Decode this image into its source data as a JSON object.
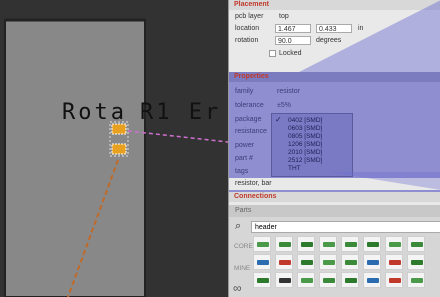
{
  "canvas": {
    "part_label": "Rota",
    "part_label2": "R1 Er",
    "colors": {
      "trace": "#c06a2a",
      "ratsnest": "#d070d0",
      "board": "#888888"
    }
  },
  "inspector": {
    "placement": {
      "header": "Placement",
      "pcb_layer_label": "pcb layer",
      "pcb_layer_value": "top",
      "location_label": "location",
      "location_x": "1.467",
      "location_y": "0.433",
      "location_unit": "in",
      "rotation_label": "rotation",
      "rotation_value": "90.0",
      "rotation_unit": "degrees",
      "locked_label": "Locked"
    },
    "properties": {
      "header": "Properties",
      "family_label": "family",
      "family_value": "resistor",
      "tolerance_label": "tolerance",
      "tolerance_value": "±5%",
      "package_label": "package",
      "resistance_label": "resistance",
      "power_label": "power",
      "partno_label": "part #",
      "tags_label": "tags",
      "tags_value": "resistor, bar",
      "package_options": [
        "0402 [SMD]",
        "0603 [SMD]",
        "0805 [SMD]",
        "1206 [SMD]",
        "2010 [SMD]",
        "2512 [SMD]",
        "THT"
      ],
      "package_selected": "0402 [SMD]"
    },
    "connections_header": "Connections"
  },
  "parts": {
    "header": "Parts",
    "search_value": "header",
    "side_tabs": [
      "CORE",
      "MINE"
    ]
  }
}
